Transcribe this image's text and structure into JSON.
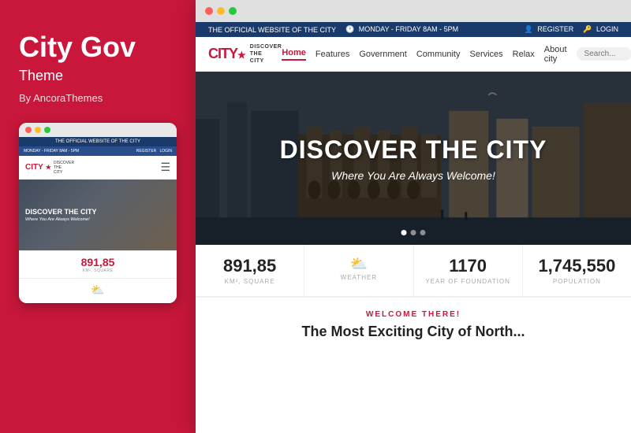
{
  "left": {
    "title": "City Gov",
    "subtitle": "Theme",
    "author": "By AncoraThemes",
    "mobile": {
      "topbar": "THE OFFICIAL WEBSITE OF THE CITY",
      "info_left": "MONDAY - FRIDAY 8AM - 5PM",
      "info_right_register": "REGISTER",
      "info_right_login": "LOGIN",
      "logo_text": "CITY",
      "logo_sub": "DISCOVER\nTHE\nCITY",
      "hero_title": "DISCOVER THE CITY",
      "hero_subtitle": "Where You Are Always Welcome!",
      "stat_number": "891,85",
      "stat_label": "KM², SQUARE"
    }
  },
  "right": {
    "topbar": {
      "official": "THE OFFICIAL WEBSITE OF THE CITY",
      "hours": "MONDAY - FRIDAY 8AM - 5PM",
      "register": "REGISTER",
      "login": "LOGIN"
    },
    "nav": {
      "logo_text": "CITY",
      "logo_tagline": "DISCOVER\nTHE\nCITY",
      "links": [
        "Home",
        "Features",
        "Government",
        "Community",
        "Services",
        "Relax",
        "About city"
      ],
      "active_link": "Home"
    },
    "hero": {
      "title": "DISCOVER THE CITY",
      "subtitle": "Where You Are Always Welcome!"
    },
    "stats": [
      {
        "number": "891,85",
        "label": "KM², SQUARE",
        "has_icon": false
      },
      {
        "number": "",
        "label": "WEATHER",
        "has_icon": true
      },
      {
        "number": "1170",
        "label": "YEAR OF FOUNDATION",
        "has_icon": false
      },
      {
        "number": "1,745,550",
        "label": "POPULATION",
        "has_icon": false
      }
    ],
    "welcome": {
      "label": "WELCOME THERE!",
      "title": "The Most Exciting City of North..."
    }
  }
}
